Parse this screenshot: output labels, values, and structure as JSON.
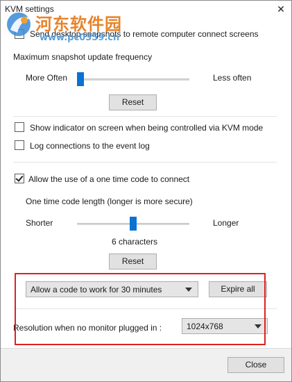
{
  "window": {
    "title": "KVM settings",
    "close_glyph": "✕"
  },
  "watermark": {
    "site_name": "河东软件园",
    "url": "www.pc0359.cn"
  },
  "snapshots": {
    "send_label": "Send desktop snapshots to remote computer connect screens",
    "send_checked": false,
    "frequency_label": "Maximum snapshot update frequency",
    "slider_left_label": "More Often",
    "slider_right_label": "Less often",
    "slider_value_fraction": 0.0,
    "reset_label": "Reset"
  },
  "options": {
    "show_indicator_label": "Show indicator on screen when being controlled via KVM mode",
    "show_indicator_checked": false,
    "log_connections_label": "Log connections to the event log",
    "log_connections_checked": false
  },
  "one_time_code": {
    "allow_label": "Allow the use of a one time code to connect",
    "allow_checked": true,
    "length_label": "One time code length (longer is more secure)",
    "slider_left_label": "Shorter",
    "slider_right_label": "Longer",
    "slider_value_fraction": 0.5,
    "length_value": "6 characters",
    "reset_label": "Reset",
    "duration_selected": "Allow a code to work for 30 minutes",
    "expire_all_label": "Expire all"
  },
  "resolution": {
    "label": "Resolution when no monitor plugged in :",
    "selected": "1024x768"
  },
  "footer": {
    "close_label": "Close"
  },
  "colors": {
    "accent": "#0a72d4",
    "highlight_box": "#e02020",
    "watermark_text": "#e8832a",
    "watermark_url": "#5aa0dc"
  }
}
